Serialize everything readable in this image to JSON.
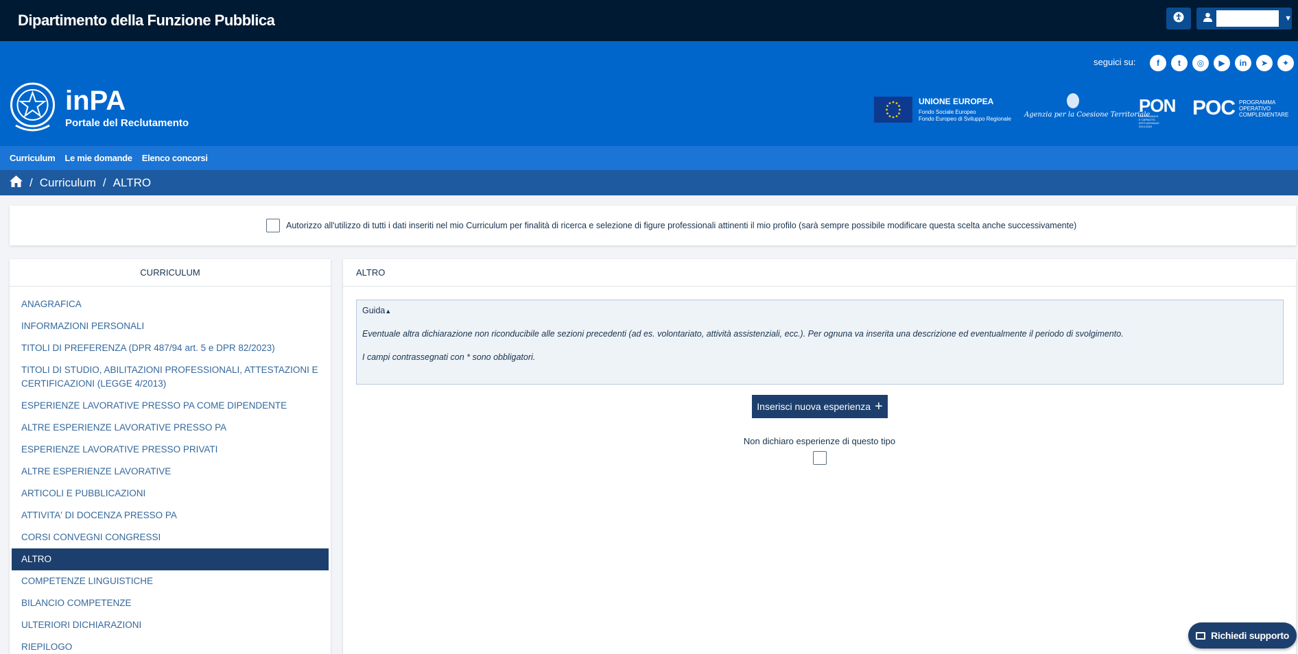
{
  "topbar": {
    "department": "Dipartimento della Funzione Pubblica",
    "accessibility_icon": "accessibility-icon",
    "user_icon": "user-icon"
  },
  "header": {
    "follow_label": "seguici su:",
    "socials": [
      "f",
      "t",
      "◎",
      "▶",
      "in",
      "➤",
      "✦"
    ],
    "brand_name": "inPA",
    "brand_subtitle": "Portale del Reclutamento",
    "eu_title": "UNIONE EUROPEA",
    "eu_line1": "Fondo Sociale Europeo",
    "eu_line2": "Fondo Europeo di Sviluppo Regionale",
    "agency_text": "Agenzia per la Coesione Territoriale",
    "pon_text": "PON",
    "pon_sub1": "GOVERNANCE",
    "pon_sub2": "E CAPACITÀ",
    "pon_sub3": "ISTITUZIONALE",
    "pon_sub4": "2014-2020",
    "poc_text": "POC",
    "poc_sub1": "PROGRAMMA",
    "poc_sub2": "OPERATIVO",
    "poc_sub3": "COMPLEMENTARE"
  },
  "nav": [
    "Curriculum",
    "Le mie domande",
    "Elenco concorsi"
  ],
  "breadcrumb": {
    "home_icon": "home-icon",
    "items": [
      "Curriculum",
      "ALTRO"
    ]
  },
  "consent": {
    "text": "Autorizzo all'utilizzo di tutti i dati inseriti nel mio Curriculum per finalità di ricerca e selezione di figure professionali attinenti il mio profilo (sarà sempre possibile modificare questa scelta anche successivamente)"
  },
  "sidebar": {
    "title": "CURRICULUM",
    "items": [
      "ANAGRAFICA",
      "INFORMAZIONI PERSONALI",
      "TITOLI DI PREFERENZA (DPR 487/94 art. 5 e DPR 82/2023)",
      "TITOLI DI STUDIO, ABILITAZIONI PROFESSIONALI, ATTESTAZIONI E CERTIFICAZIONI (LEGGE 4/2013)",
      "ESPERIENZE LAVORATIVE PRESSO PA COME DIPENDENTE",
      "ALTRE ESPERIENZE LAVORATIVE PRESSO PA",
      "ESPERIENZE LAVORATIVE PRESSO PRIVATI",
      "ALTRE ESPERIENZE LAVORATIVE",
      "ARTICOLI E PUBBLICAZIONI",
      "ATTIVITA' DI DOCENZA PRESSO PA",
      "CORSI CONVEGNI CONGRESSI",
      "ALTRO",
      "COMPETENZE LINGUISTICHE",
      "BILANCIO COMPETENZE",
      "ULTERIORI DICHIARAZIONI",
      "RIEPILOGO"
    ],
    "active_index": 11
  },
  "main": {
    "title": "ALTRO",
    "guide_label": "Guida",
    "guide_text1": "Eventuale altra dichiarazione non riconducibile alle sezioni precedenti (ad es. volontariato, attività assistenziali, ecc.). Per ognuna va inserita una descrizione ed eventualmente il periodo di svolgimento.",
    "guide_text2": "I campi contrassegnati con * sono obbligatori.",
    "add_button": "Inserisci nuova esperienza",
    "no_declare_label": "Non dichiaro esperienze di questo tipo"
  },
  "support": {
    "label": "Richiedi supporto"
  },
  "colors": {
    "topbar": "#011a33",
    "header": "#0066cc",
    "nav": "#1a75d6",
    "breadcrumb": "#1d5aa0",
    "active": "#1d3f6d"
  }
}
